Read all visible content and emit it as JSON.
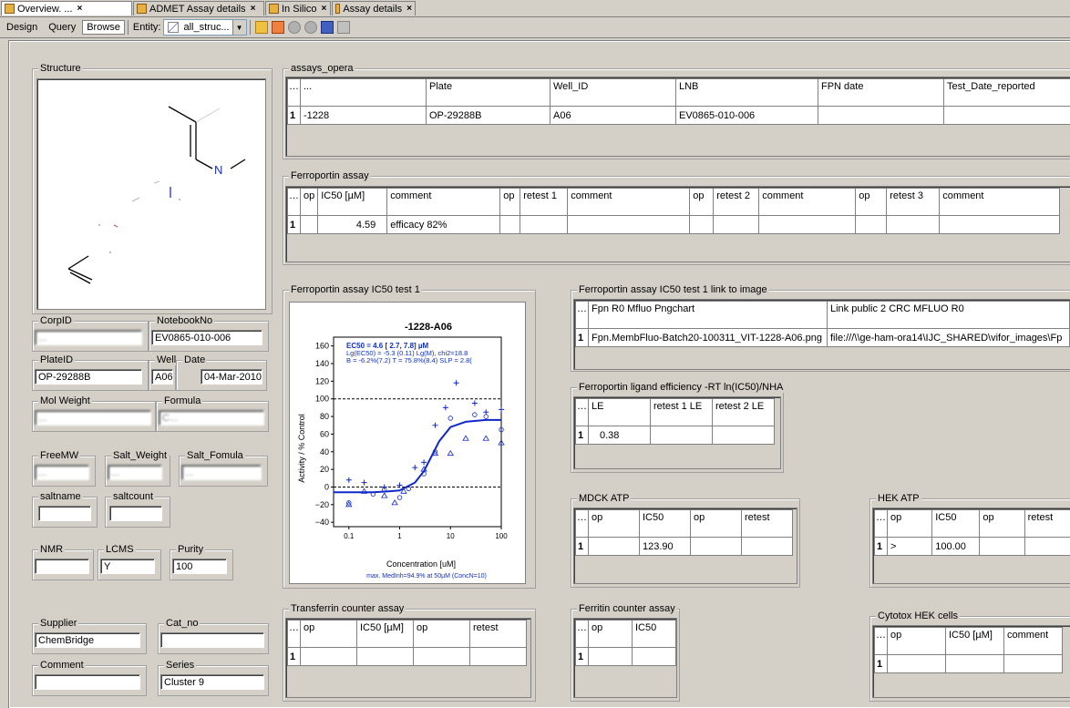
{
  "tabs": [
    {
      "label": "Overview. ...",
      "active": true
    },
    {
      "label": "ADMET Assay details"
    },
    {
      "label": "In Silico"
    },
    {
      "label": "Assay details"
    }
  ],
  "toolbar": {
    "design": "Design",
    "query": "Query",
    "browse": "Browse",
    "entity_label": "Entity:",
    "entity_value": "all_struc..."
  },
  "left": {
    "structure_label": "Structure",
    "corpid_label": "CorpID",
    "corpid_value": "...",
    "notebook_label": "NotebookNo",
    "notebook_value": "EV0865-010-006",
    "plateid_label": "PlateID",
    "plateid_value": "OP-29288B",
    "well_label": "Well",
    "well_value": "A06",
    "date_label": "Date",
    "date_value": "04-Mar-2010",
    "molweight_label": "Mol Weight",
    "molweight_value": "...",
    "formula_label": "Formula",
    "formula_value": "C...",
    "freemw_label": "FreeMW",
    "freemw_value": "...",
    "saltweight_label": "Salt_Weight",
    "saltweight_value": "...",
    "saltformula_label": "Salt_Fomula",
    "saltformula_value": "...",
    "saltname_label": "saltname",
    "saltname_value": "",
    "saltcount_label": "saltcount",
    "saltcount_value": "",
    "nmr_label": "NMR",
    "nmr_value": "",
    "lcms_label": "LCMS",
    "lcms_value": "Y",
    "purity_label": "Purity",
    "purity_value": "100",
    "supplier_label": "Supplier",
    "supplier_value": "ChemBridge",
    "catno_label": "Cat_no",
    "catno_value": "",
    "comment_label": "Comment",
    "comment_value": "",
    "series_label": "Series",
    "series_value": "Cluster 9",
    "structure_atom": "N"
  },
  "assays_opera": {
    "label": "assays_opera",
    "headers": [
      "...",
      "Plate",
      "Well_ID",
      "LNB",
      "FPN date",
      "Test_Date_reported"
    ],
    "row": [
      "1",
      "-1228",
      "OP-29288B",
      "A06",
      "EV0865-010-006",
      "",
      ""
    ]
  },
  "ferroportin": {
    "label": "Ferroportin assay",
    "headers": [
      "op",
      "IC50 [µM]",
      "comment",
      "op",
      "retest 1",
      "comment",
      "op",
      "retest 2",
      "comment",
      "op",
      "retest 3",
      "comment"
    ],
    "row": [
      "1",
      "",
      "4.59",
      "efficacy 82%",
      "",
      "",
      "",
      "",
      "",
      "",
      "",
      "",
      ""
    ]
  },
  "ic50chart": {
    "label": "Ferroportin assay IC50 test 1",
    "title": "-1228-A06",
    "line1": "EC50 =   4.6 [ 2.7, 7.8] µM",
    "line2": "Lg(EC50) = -5.3 (0.11) Lg(M), chi2=18.8",
    "line3": "B = -6.2%(7.2)  T = 75.8%(8.4) SLP = 2.8(",
    "footer": "max. MedInh=94.9%  at 50µM (ConcN=10)"
  },
  "chart_data": {
    "type": "scatter",
    "title": "-1228-A06",
    "xlabel": "Concentration [uM]",
    "ylabel": "Activity / % Control",
    "xscale": "log",
    "xlim": [
      0.05,
      100
    ],
    "ylim": [
      -45,
      170
    ],
    "xticks": [
      "0.1",
      "1",
      "10",
      "100"
    ],
    "yticks": [
      "160",
      "140",
      "120",
      "100",
      "80",
      "60",
      "40",
      "20",
      "0",
      "−20",
      "−40"
    ],
    "series": [
      {
        "marker": "plus",
        "x": [
          0.1,
          0.2,
          0.5,
          1,
          2,
          3,
          5,
          8,
          13,
          30,
          50,
          100
        ],
        "y": [
          8,
          5,
          0,
          2,
          22,
          28,
          70,
          90,
          118,
          95,
          85,
          88
        ]
      },
      {
        "marker": "circle",
        "x": [
          0.1,
          0.3,
          0.5,
          1,
          1.5,
          3,
          5,
          10,
          30,
          50,
          100
        ],
        "y": [
          -18,
          -8,
          -3,
          -12,
          -2,
          15,
          40,
          78,
          82,
          80,
          65
        ]
      },
      {
        "marker": "triangle",
        "x": [
          0.1,
          0.2,
          0.5,
          0.8,
          1.2,
          3,
          5,
          10,
          20,
          50,
          100
        ],
        "y": [
          -20,
          -5,
          -10,
          -18,
          -5,
          20,
          38,
          38,
          55,
          55,
          50
        ]
      },
      {
        "marker": "fit",
        "x": [
          0.05,
          0.1,
          0.3,
          0.6,
          1,
          2,
          3,
          4,
          6,
          10,
          20,
          50,
          100
        ],
        "y": [
          -6,
          -6,
          -6,
          -5,
          -4,
          5,
          18,
          32,
          52,
          68,
          74,
          76,
          76
        ]
      }
    ],
    "reference_lines": [
      100,
      0
    ]
  },
  "linkimage": {
    "label": "Ferroportin assay IC50 test 1 link to image",
    "headers": [
      "Fpn R0 Mfluo Pngchart",
      "Link public 2 CRC MFLUO R0"
    ],
    "row": [
      "1",
      "Fpn.MembFluo-Batch20-100311_VIT-1228-A06.png",
      "file:///\\\\ge-ham-ora14\\IJC_SHARED\\vifor_images\\Fp"
    ]
  },
  "ligand": {
    "label": "Ferroportin ligand efficiency -RT ln(IC50)/NHA",
    "headers": [
      "LE",
      "retest 1 LE",
      "retest 2 LE"
    ],
    "row": [
      "1",
      "0.38",
      "",
      ""
    ]
  },
  "mdck": {
    "label": "MDCK ATP",
    "headers": [
      "op",
      "IC50",
      "op",
      "retest"
    ],
    "row": [
      "1",
      "",
      "123.90",
      "",
      ""
    ]
  },
  "hek": {
    "label": "HEK ATP",
    "headers": [
      "op",
      "IC50",
      "op",
      "retest"
    ],
    "row": [
      "1",
      ">",
      "100.00",
      "",
      ""
    ]
  },
  "transferrin": {
    "label": "Transferrin counter assay",
    "headers": [
      "op",
      "IC50 [µM]",
      "op",
      "retest"
    ],
    "row": [
      "1",
      "",
      "",
      "",
      ""
    ]
  },
  "ferritin": {
    "label": "Ferritin counter assay",
    "headers": [
      "op",
      "IC50"
    ],
    "row": [
      "1",
      "",
      ""
    ]
  },
  "cytotox": {
    "label": "Cytotox HEK cells",
    "headers": [
      "op",
      "IC50 [µM]",
      "comment"
    ],
    "row": [
      "1",
      "",
      "",
      ""
    ]
  }
}
